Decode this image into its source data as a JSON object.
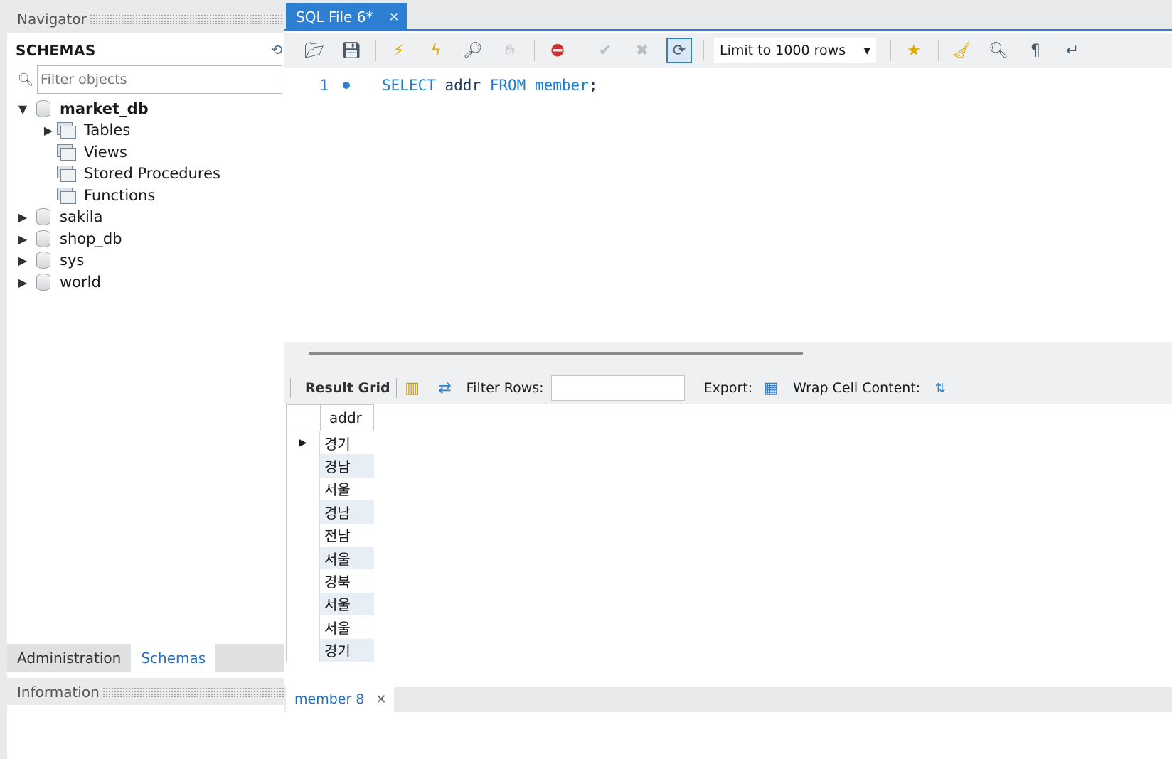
{
  "navigator": {
    "title": "Navigator",
    "schemas_label": "SCHEMAS",
    "filter_placeholder": "Filter objects",
    "tree": {
      "market_db": {
        "name": "market_db",
        "children": [
          "Tables",
          "Views",
          "Stored Procedures",
          "Functions"
        ]
      },
      "others": [
        "sakila",
        "shop_db",
        "sys",
        "world"
      ]
    },
    "bottom_tabs": [
      "Administration",
      "Schemas"
    ],
    "info_title": "Information"
  },
  "editor": {
    "tab_title": "SQL File 6*",
    "limit_label": "Limit to 1000 rows",
    "line_number": "1",
    "sql": {
      "kw1": "SELECT",
      "id1": "addr",
      "kw2": "FROM",
      "id2": "member",
      "end": ";"
    }
  },
  "result": {
    "grid_label": "Result Grid",
    "filter_rows_label": "Filter Rows:",
    "export_label": "Export:",
    "wrap_label": "Wrap Cell Content:",
    "column": "addr",
    "rows": [
      "경기",
      "경남",
      "서울",
      "경남",
      "전남",
      "서울",
      "경북",
      "서울",
      "서울",
      "경기"
    ],
    "tab_label": "member 8"
  },
  "colors": {
    "accent": "#2c7fd1",
    "keyword": "#1a7fd4"
  }
}
